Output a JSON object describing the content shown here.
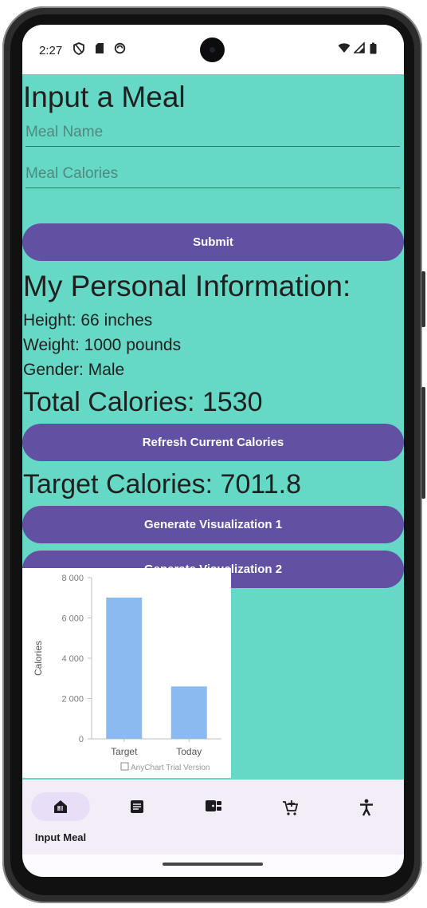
{
  "status": {
    "time": "2:27",
    "icons": [
      "vpn-shield-icon",
      "sd-card-icon",
      "sync-icon"
    ],
    "right_icons": [
      "wifi-icon",
      "signal-icon",
      "battery-icon"
    ]
  },
  "meal": {
    "title": "Input a Meal",
    "name_placeholder": "Meal Name",
    "calories_placeholder": "Meal Calories",
    "submit_label": "Submit"
  },
  "personal": {
    "title": "My Personal Information:",
    "height": "Height: 66 inches",
    "weight": "Weight: 1000 pounds",
    "gender": "Gender: Male"
  },
  "calories": {
    "total": "Total Calories: 1530",
    "refresh_label": "Refresh Current Calories",
    "target": "Target Calories: 7011.8",
    "viz1_label": "Generate Visualization 1",
    "viz2_label": "Generate Visualization 2"
  },
  "chart_data": {
    "type": "bar",
    "categories": [
      "Target",
      "Today"
    ],
    "values": [
      7011.8,
      2600
    ],
    "ylabel": "Calories",
    "ylim": [
      0,
      8000
    ],
    "yticks": [
      "0",
      "2 000",
      "4 000",
      "6 000",
      "8 000"
    ],
    "tick_values": [
      0,
      2000,
      4000,
      6000,
      8000
    ],
    "bar_color": "#8bbaf0",
    "credit": "AnyChart Trial Version",
    "grid": false
  },
  "nav": {
    "items": [
      {
        "icon": "meal-icon",
        "label": "Input Meal",
        "active": true
      },
      {
        "icon": "article-icon",
        "label": "",
        "active": false
      },
      {
        "icon": "wallet-icon",
        "label": "",
        "active": false
      },
      {
        "icon": "cart-add-icon",
        "label": "",
        "active": false
      },
      {
        "icon": "accessibility-icon",
        "label": "",
        "active": false
      }
    ]
  },
  "colors": {
    "background": "#65d8c6",
    "button": "#6250a2",
    "nav_background": "#f2edf6",
    "nav_active_pill": "#e8def8"
  }
}
